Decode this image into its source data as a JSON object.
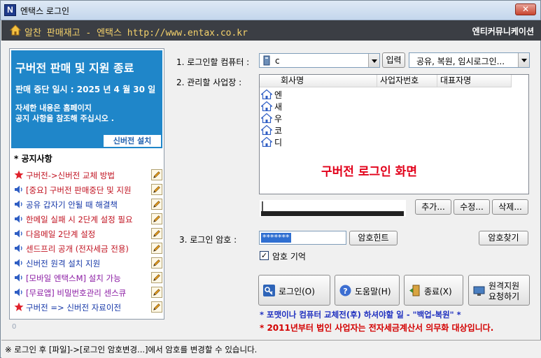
{
  "window": {
    "title": "엔택스 로그인",
    "app_icon_letter": "N",
    "close_label": "✕"
  },
  "banner": {
    "left_text": "알찬 판매재고 - 엔택스 http://www.entax.co.kr",
    "right_text": "엔티커뮤니케이션"
  },
  "notice_box": {
    "title": "구버전 판매 및 지원 종료",
    "line1": "판매 중단 일시 : 2025 년 4 월 30 일",
    "line2": "자세한 내용은 홈페이지",
    "line3": "공지 사항을 참조해 주십시오 .",
    "install_button": "신버전 설치"
  },
  "notices": {
    "title": "* 공지사항",
    "items": [
      {
        "icon": "star-icon",
        "text": "구버전->신버전 교체 방법",
        "color": "#c0111f"
      },
      {
        "icon": "speaker-icon",
        "text": "[중요] 구버전 판매중단 및 지원",
        "color": "#c0111f"
      },
      {
        "icon": "speaker-icon",
        "text": "공유 갑자기 안될 때 해결책",
        "color": "#1638a8"
      },
      {
        "icon": "speaker-icon",
        "text": "한메일 실패 시 2단계 설정 필요",
        "color": "#c0111f"
      },
      {
        "icon": "speaker-icon",
        "text": "다음메일 2단계 설정",
        "color": "#c0111f"
      },
      {
        "icon": "speaker-icon",
        "text": "센드프리 공개 (전자세금 전용)",
        "color": "#c0111f"
      },
      {
        "icon": "speaker-icon",
        "text": "신버전 원격 설치 지원",
        "color": "#1638a8"
      },
      {
        "icon": "speaker-icon",
        "text": "[모바일 엔택스M] 설치 가능",
        "color": "#8a1aa3"
      },
      {
        "icon": "speaker-icon",
        "text": "[무료앱] 비밀번호관리 센스큐",
        "color": "#8a1aa3"
      },
      {
        "icon": "star-icon",
        "text": "구버전 => 신버전 자료이전",
        "color": "#1638a8"
      }
    ],
    "bottom_number": "0"
  },
  "login_form": {
    "step1_label": "1. 로그인할 컴퓨터 :",
    "computer_value": "c",
    "input_button": "입력",
    "share_combo": "공유, 복원, 임시로그인...",
    "step2_label": "2. 관리할 사업장 :",
    "columns": [
      "회사명",
      "사업자번호",
      "대표자명"
    ],
    "rows": [
      "엔",
      "새",
      "우",
      "코",
      "디"
    ],
    "screen_caption": "구버전 로그인 화면",
    "add_button": "추가...",
    "edit_button": "수정...",
    "delete_button": "삭제...",
    "step3_label": "3. 로그인 암호 :",
    "password_value": "*******",
    "hint_button": "암호힌트",
    "find_button": "암호찾기",
    "remember_label": "암호 기억",
    "remember_checked": "✓"
  },
  "actions": {
    "login": "로그인(O)",
    "help": "도움말(H)",
    "exit": "종료(X)",
    "remote_line1": "원격지원",
    "remote_line2": "요청하기"
  },
  "footer": {
    "line1": "* 포맷이나 컴퓨터 교체전(후) 하셔야할 일 - \"백업-복원\" *",
    "line2": "* 2011년부터 법인 사업자는 전자세금계산서 의무화 대상입니다."
  },
  "statusbar": {
    "text": "※ 로그인 후 [파일]->[로그인 암호변경...]에서 암호를 변경할 수 있습니다."
  }
}
